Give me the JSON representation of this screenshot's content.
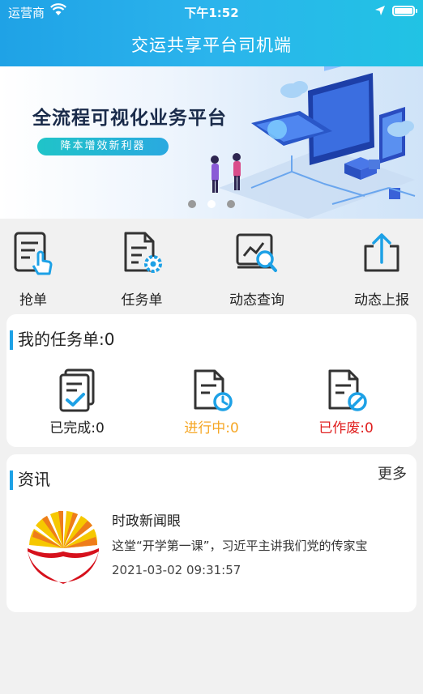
{
  "status_bar": {
    "carrier": "运营商",
    "time": "下午1:52"
  },
  "header": {
    "title": "交运共享平台司机端"
  },
  "banner": {
    "title": "全流程可视化业务平台",
    "subtitle": "降本增效新利器",
    "slides": 3,
    "active_slide": 2
  },
  "quick_actions": [
    {
      "label": "抢单",
      "icon": "grab-order-icon"
    },
    {
      "label": "任务单",
      "icon": "task-list-icon"
    },
    {
      "label": "动态查询",
      "icon": "dynamic-query-icon"
    },
    {
      "label": "动态上报",
      "icon": "dynamic-report-icon"
    }
  ],
  "tasks": {
    "title": "我的任务单:0",
    "items": [
      {
        "label": "已完成:0",
        "color": "#222222",
        "icon": "completed-icon"
      },
      {
        "label": "进行中:0",
        "color": "#f5a623",
        "icon": "in-progress-icon"
      },
      {
        "label": "已作废:0",
        "color": "#e02020",
        "icon": "voided-icon"
      }
    ]
  },
  "news": {
    "title": "资讯",
    "more": "更多",
    "items": [
      {
        "title": "时政新闻眼",
        "desc": "这堂“开学第一课”，习近平主讲我们党的传家宝",
        "time": "2021-03-02 09:31:57"
      }
    ]
  },
  "colors": {
    "accent": "#1da1e6",
    "header_start": "#1fa2e6",
    "header_end": "#21c3e4"
  }
}
